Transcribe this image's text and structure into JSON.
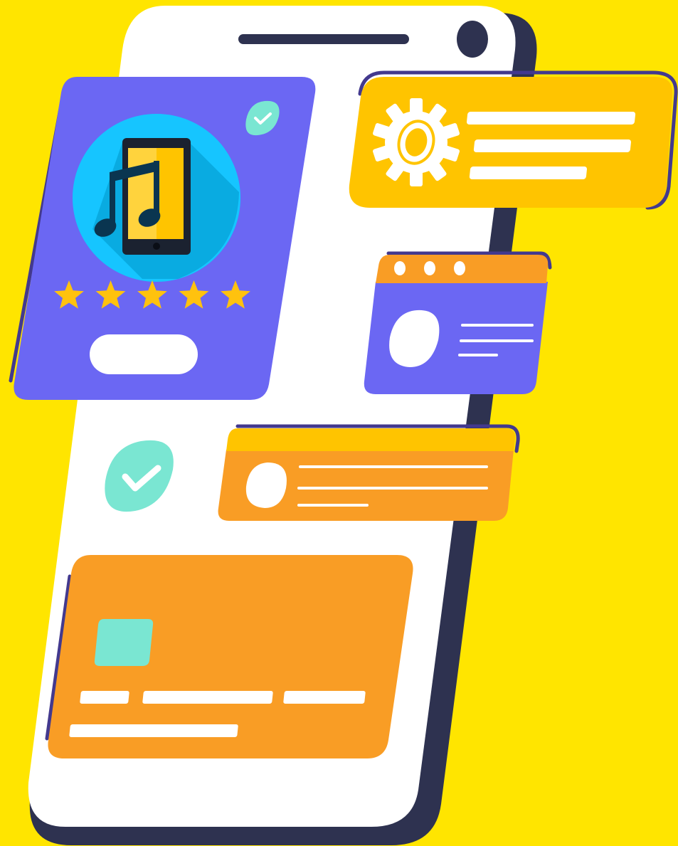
{
  "colors": {
    "background": "#FFE500",
    "phone_body": "#FFFFFF",
    "phone_shadow": "#2E3250",
    "outline": "#43398E",
    "purple_card": "#6B67F3",
    "yellow_card": "#FFC400",
    "orange_card": "#F99D25",
    "teal_check": "#7AE6D2",
    "music_circle": "#00BFFF",
    "music_shadow": "#0096C8",
    "star": "#FFC20E",
    "note_dark": "#0A3550"
  },
  "icons": {
    "status_check": "check-badge-icon",
    "rating_check": "check-badge-icon",
    "music": "music-phone-icon",
    "settings": "gear-icon",
    "browser_avatar": "avatar-icon",
    "message_avatar": "avatar-icon",
    "card_chip": "card-chip-icon"
  },
  "rating": {
    "stars_filled": 5,
    "stars_total": 5
  },
  "browser_window": {
    "dot_count": 3
  }
}
